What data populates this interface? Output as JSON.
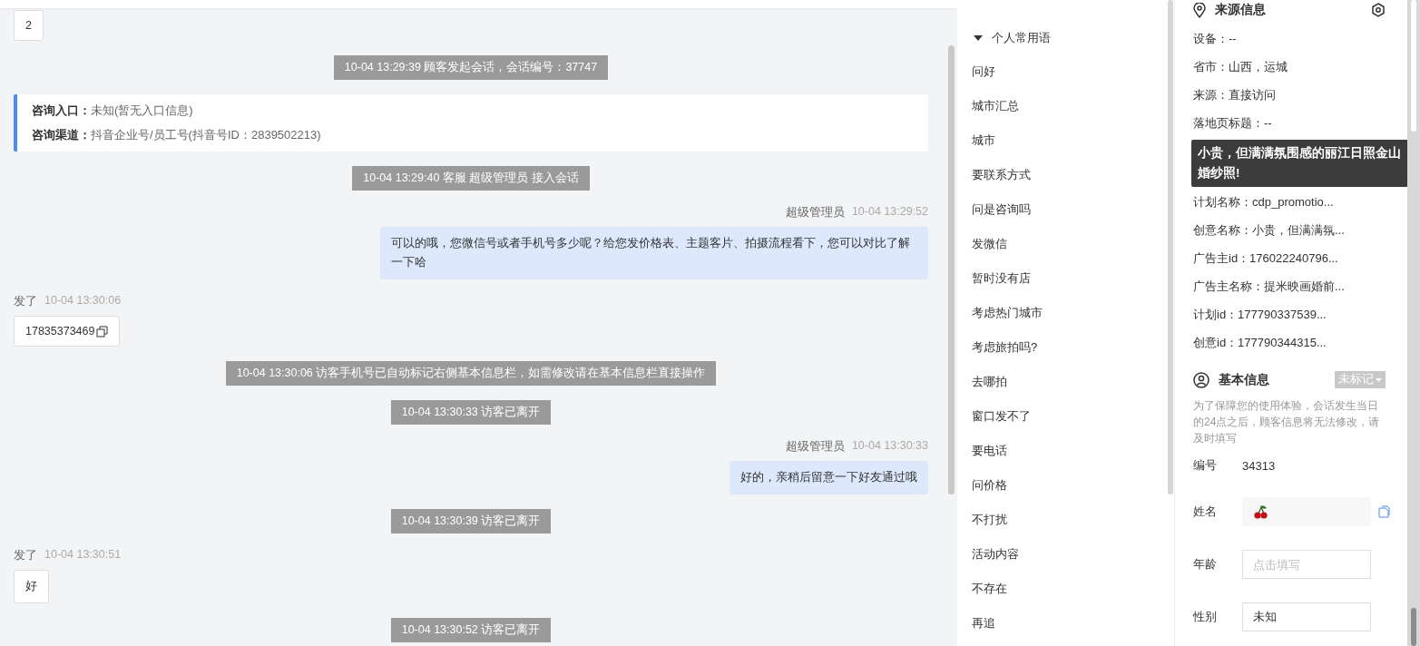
{
  "chat": {
    "messages": [
      {
        "kind": "visitor",
        "text": "2",
        "copyable": false
      },
      {
        "kind": "system",
        "text": "10-04 13:29:39 顾客发起会话，会话编号：37747"
      },
      {
        "kind": "info_card",
        "lines": [
          {
            "label": "咨询入口：",
            "value": "未知(暂无入口信息)"
          },
          {
            "label": "咨询渠道：",
            "value": "抖音企业号/员工号(抖音号ID：2839502213)"
          }
        ]
      },
      {
        "kind": "system",
        "text": "10-04 13:29:40 客服 超级管理员 接入会话"
      },
      {
        "kind": "agent",
        "sender": "超级管理员",
        "time": "10-04 13:29:52",
        "text": "可以的哦，您微信号或者手机号多少呢？给您发价格表、主题客片、拍摄流程看下，您可以对比了解一下哈"
      },
      {
        "kind": "visitor",
        "sender": "发了",
        "time": "10-04 13:30:06",
        "text": "17835373469",
        "copyable": true
      },
      {
        "kind": "system",
        "text": "10-04 13:30:06 访客手机号已自动标记右侧基本信息栏，如需修改请在基本信息栏直接操作"
      },
      {
        "kind": "system",
        "text": "10-04 13:30:33 访客已离开"
      },
      {
        "kind": "agent",
        "sender": "超级管理员",
        "time": "10-04 13:30:33",
        "text": "好的，亲稍后留意一下好友通过哦"
      },
      {
        "kind": "system",
        "text": "10-04 13:30:39 访客已离开"
      },
      {
        "kind": "visitor",
        "sender": "发了",
        "time": "10-04 13:30:51",
        "text": "好",
        "copyable": false
      },
      {
        "kind": "system",
        "text": "10-04 13:30:52 访客已离开"
      }
    ]
  },
  "phrases": {
    "title": "个人常用语",
    "expanded": true,
    "items": [
      "问好",
      "城市汇总",
      "城市",
      "要联系方式",
      "问是咨询吗",
      "发微信",
      "暂时没有店",
      "考虑热门城市",
      "考虑旅拍吗?",
      "去哪拍",
      "窗口发不了",
      "要电话",
      "问价格",
      "不打扰",
      "活动内容",
      "不存在",
      "再追"
    ]
  },
  "source_info": {
    "title": "来源信息",
    "fields_before": [
      "设备：--",
      "省市：山西，运城",
      "来源：直接访问",
      "落地页标题：--"
    ],
    "tooltip": "小贵，但满满氛围感的丽江日照金山婚纱照!",
    "fields_after": [
      "计划名称：cdp_promotio...",
      "创意名称：小贵，但满满氛...",
      "广告主id：176022240796...",
      "广告主名称：提米映画婚前...",
      "计划id：177790337539...",
      "创意id：177790344315..."
    ]
  },
  "basic_info": {
    "title": "基本信息",
    "tag": "未标记",
    "note": "为了保障您的使用体验，会话发生当日的24点之后，顾客信息将无法修改，请及时填写",
    "fields": [
      {
        "kind": "text",
        "label": "编号",
        "value": "34313"
      },
      {
        "kind": "name",
        "label": "姓名"
      },
      {
        "kind": "input",
        "label": "年龄",
        "placeholder": "点击填写"
      },
      {
        "kind": "input",
        "label": "性别",
        "value": "未知"
      }
    ]
  }
}
